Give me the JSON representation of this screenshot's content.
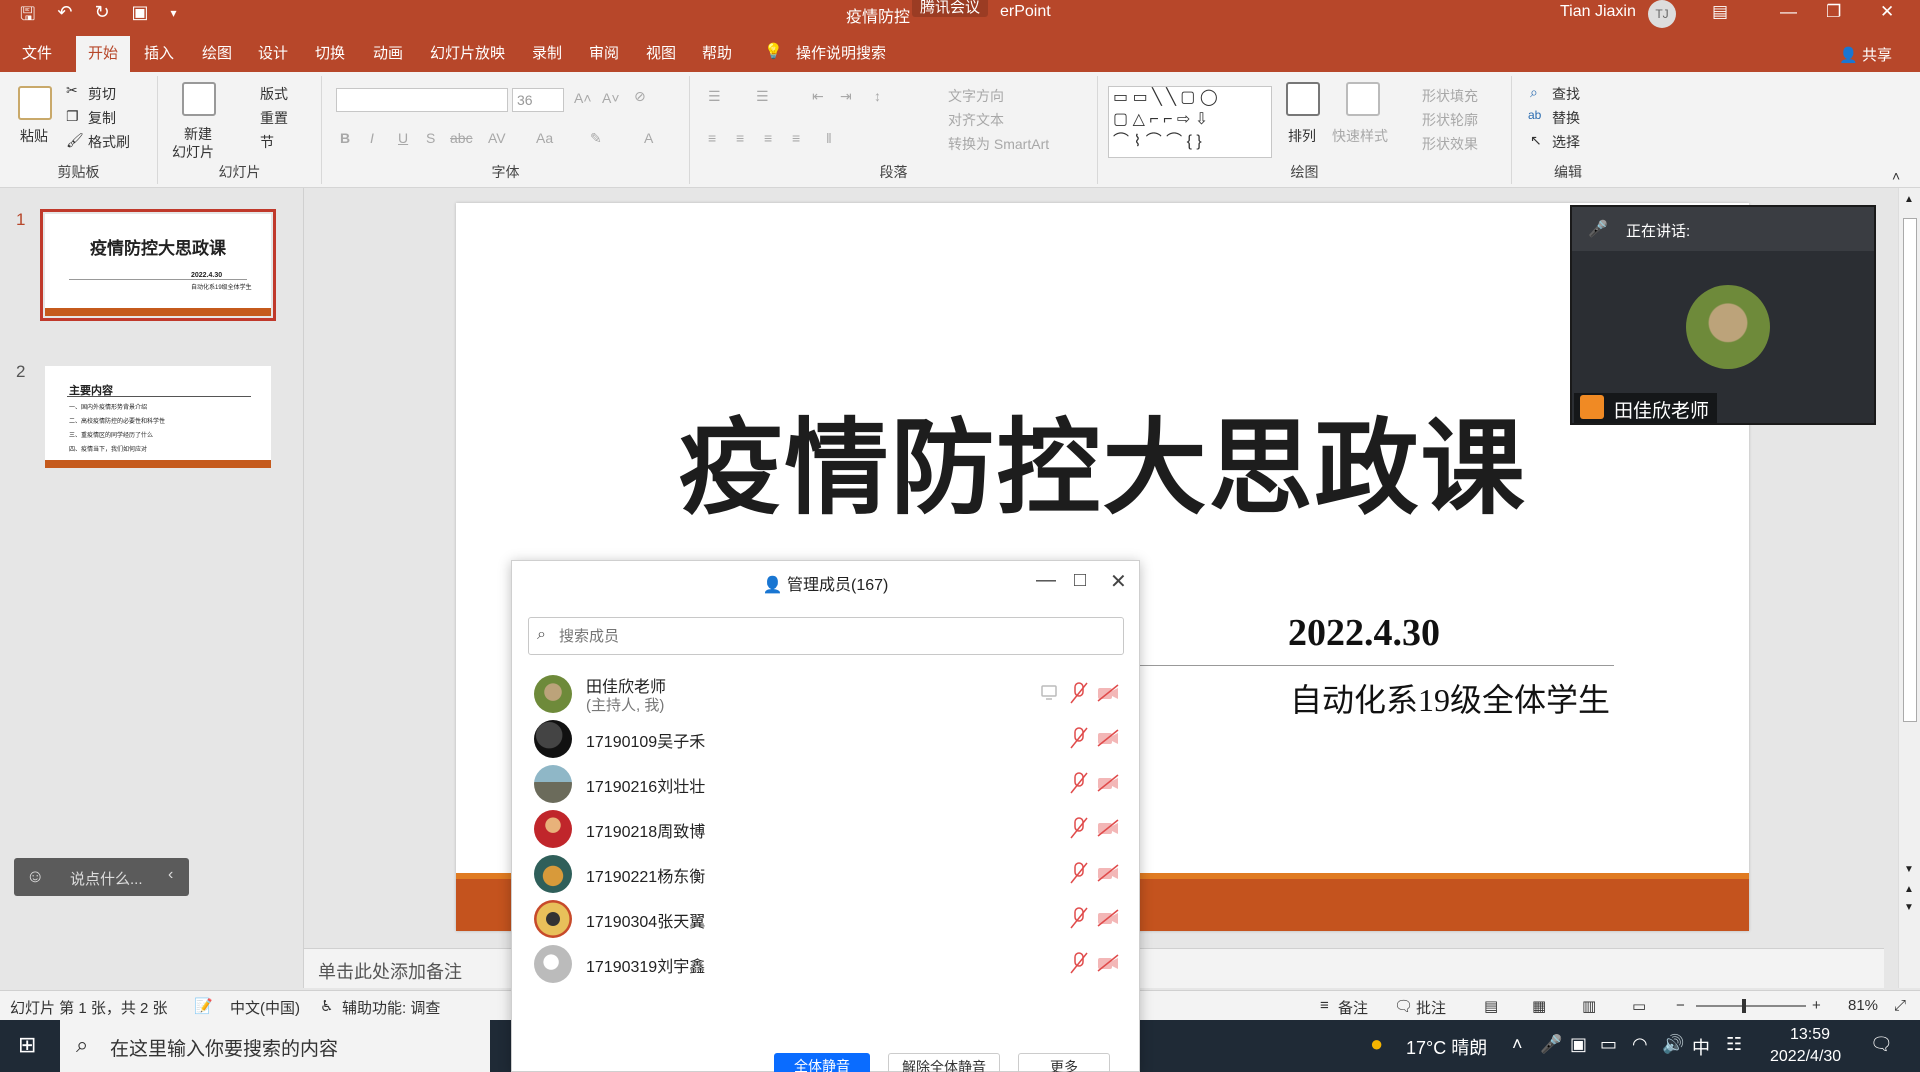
{
  "window": {
    "doc_title": "疫情防控",
    "app_suffix": "erPoint",
    "meeting_tag": "腾讯会议",
    "user_name": "Tian Jiaxin",
    "user_initials": "TJ"
  },
  "tabs": [
    "文件",
    "开始",
    "插入",
    "绘图",
    "设计",
    "切换",
    "动画",
    "幻灯片放映",
    "录制",
    "审阅",
    "视图",
    "帮助",
    "操作说明搜索"
  ],
  "share_label": "共享",
  "ribbon": {
    "clipboard": {
      "paste": "粘贴",
      "cut": "剪切",
      "copy": "复制",
      "format_painter": "格式刷",
      "label": "剪贴板"
    },
    "slides": {
      "new_slide": "新建",
      "new_slide2": "幻灯片",
      "layout": "版式",
      "reset": "重置",
      "section": "节",
      "label": "幻灯片"
    },
    "font": {
      "size": "36",
      "label": "字体"
    },
    "paragraph": {
      "text_direction": "文字方向",
      "align_text": "对齐文本",
      "convert_smartart": "转换为 SmartArt",
      "label": "段落"
    },
    "drawing": {
      "arrange": "排列",
      "quick_styles": "快速样式",
      "shape_fill": "形状填充",
      "shape_outline": "形状轮廓",
      "shape_effects": "形状效果",
      "label": "绘图"
    },
    "editing": {
      "find": "查找",
      "replace": "替换",
      "select": "选择",
      "label": "编辑"
    }
  },
  "thumbnails": [
    {
      "num": "1",
      "title": "疫情防控大思政课",
      "date": "2022.4.30",
      "sub": "自动化系19级全体学生"
    },
    {
      "num": "2",
      "title": "主要内容",
      "items": [
        "一、国内外疫情形势背景介绍",
        "二、高校疫情防控的必要性和科学性",
        "三、重疫情区的同学经历了什么",
        "四、疫情当下，我们如何应对"
      ]
    }
  ],
  "slide": {
    "title": "疫情防控大思政课",
    "date": "2022.4.30",
    "audience": "自动化系19级全体学生"
  },
  "notes_placeholder": "单击此处添加备注",
  "status": {
    "slide_info": "幻灯片 第 1 张，共 2 张",
    "language": "中文(中国)",
    "accessibility": "辅助功能: 调查",
    "notes": "备注",
    "comments": "批注",
    "zoom": "81%"
  },
  "taskbar": {
    "search_placeholder": "在这里输入你要搜索的内容",
    "weather": "17°C  晴朗",
    "ime": "中",
    "time": "13:59",
    "date": "2022/4/30"
  },
  "speaking": {
    "label": "正在讲话:",
    "name": "田佳欣老师"
  },
  "chat": {
    "placeholder": "说点什么..."
  },
  "members": {
    "title": "管理成员(167)",
    "search_placeholder": "搜索成员",
    "list": [
      {
        "name": "田佳欣老师",
        "sub": "(主持人, 我)"
      },
      {
        "name": "17190109吴子禾"
      },
      {
        "name": "17190216刘壮壮"
      },
      {
        "name": "17190218周致博"
      },
      {
        "name": "17190221杨东衡"
      },
      {
        "name": "17190304张天翼"
      },
      {
        "name": "17190319刘宇鑫"
      }
    ],
    "buttons": [
      "全体静音",
      "解除全体静音",
      "更多"
    ]
  }
}
